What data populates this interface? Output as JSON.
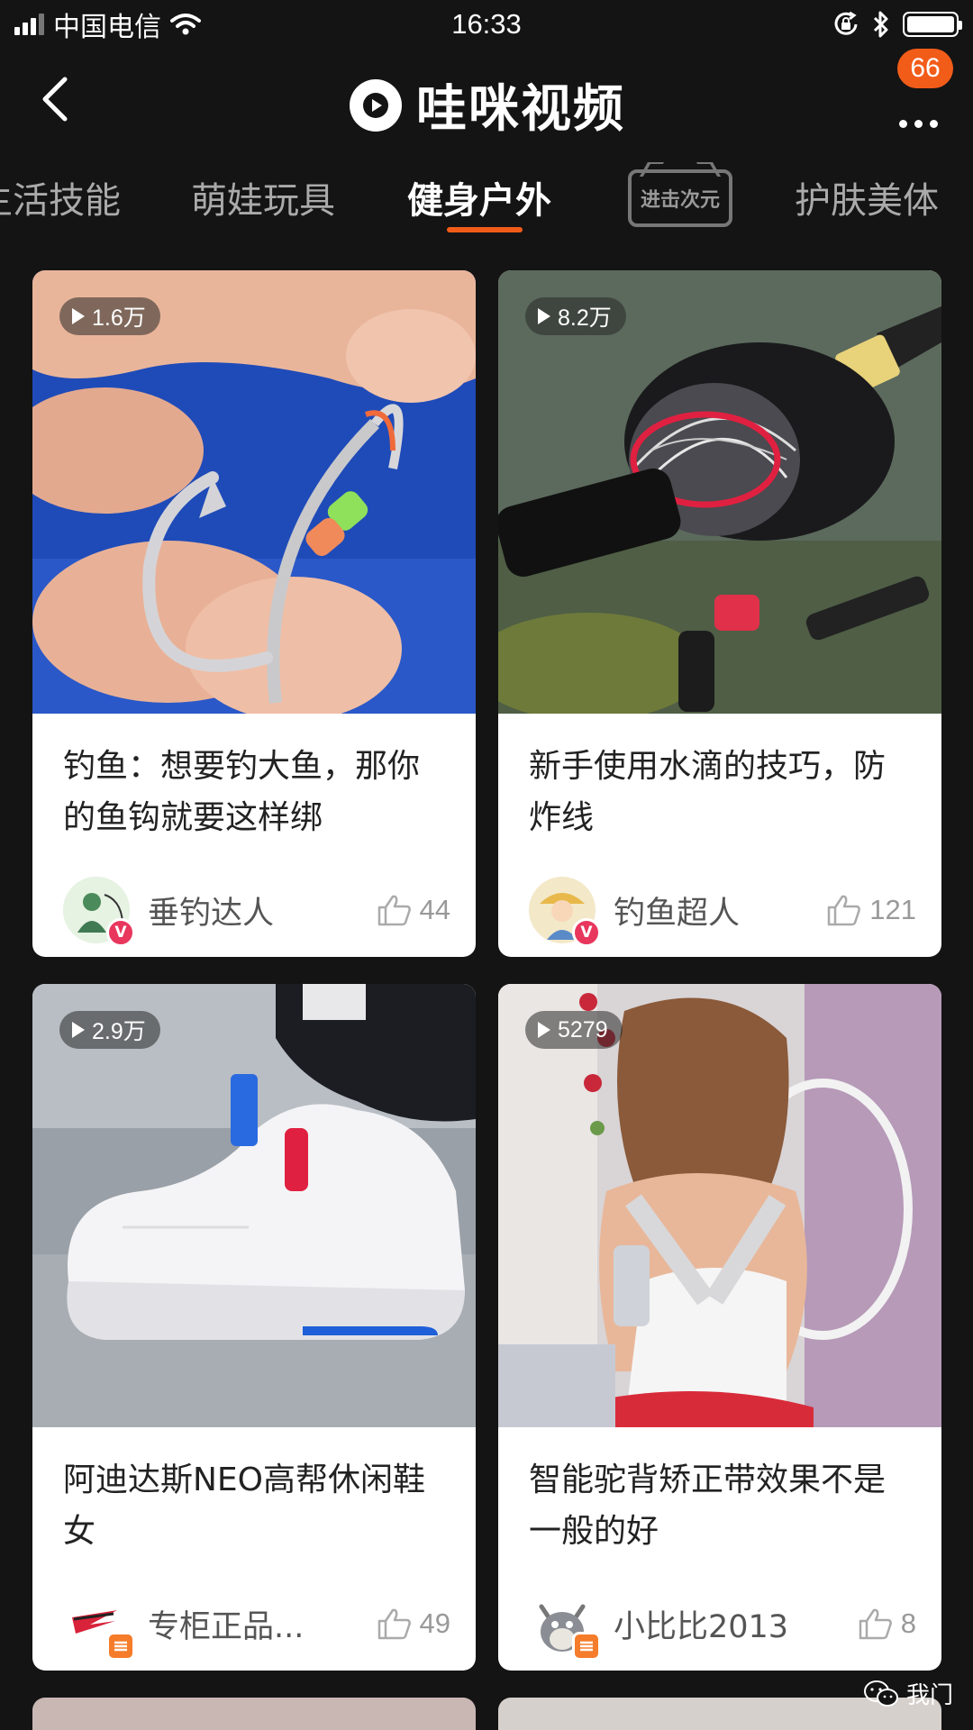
{
  "status": {
    "carrier": "中国电信",
    "time": "16:33"
  },
  "header": {
    "app_name": "哇咪视频",
    "badge_count": "66"
  },
  "tabs": [
    {
      "label": "生活技能",
      "active": false
    },
    {
      "label": "萌娃玩具",
      "active": false
    },
    {
      "label": "健身户外",
      "active": true
    },
    {
      "label": "进击次元",
      "active": false
    },
    {
      "label": "护肤美体",
      "active": false
    }
  ],
  "cards": [
    {
      "views": "1.6万",
      "title": "钓鱼：想要钓大鱼，那你的鱼钩就要这样绑",
      "author": "垂钓达人",
      "likes": "44",
      "badge": "V"
    },
    {
      "views": "8.2万",
      "title": "新手使用水滴的技巧，防炸线",
      "author": "钓鱼超人",
      "likes": "121",
      "badge": "V"
    },
    {
      "views": "2.9万",
      "title": "阿迪达斯NEO高帮休闲鞋女",
      "author": "专柜正品...",
      "likes": "49",
      "badge": "shop"
    },
    {
      "views": "5279",
      "title": "智能驼背矫正带效果不是一般的好",
      "author": "小比比2013",
      "likes": "8",
      "badge": "shop"
    }
  ],
  "watermark": "我门",
  "colors": {
    "accent": "#f25c19",
    "background": "#141414",
    "card": "#ffffff",
    "verified_badge": "#e8365d",
    "shop_badge": "#f57c2a"
  }
}
